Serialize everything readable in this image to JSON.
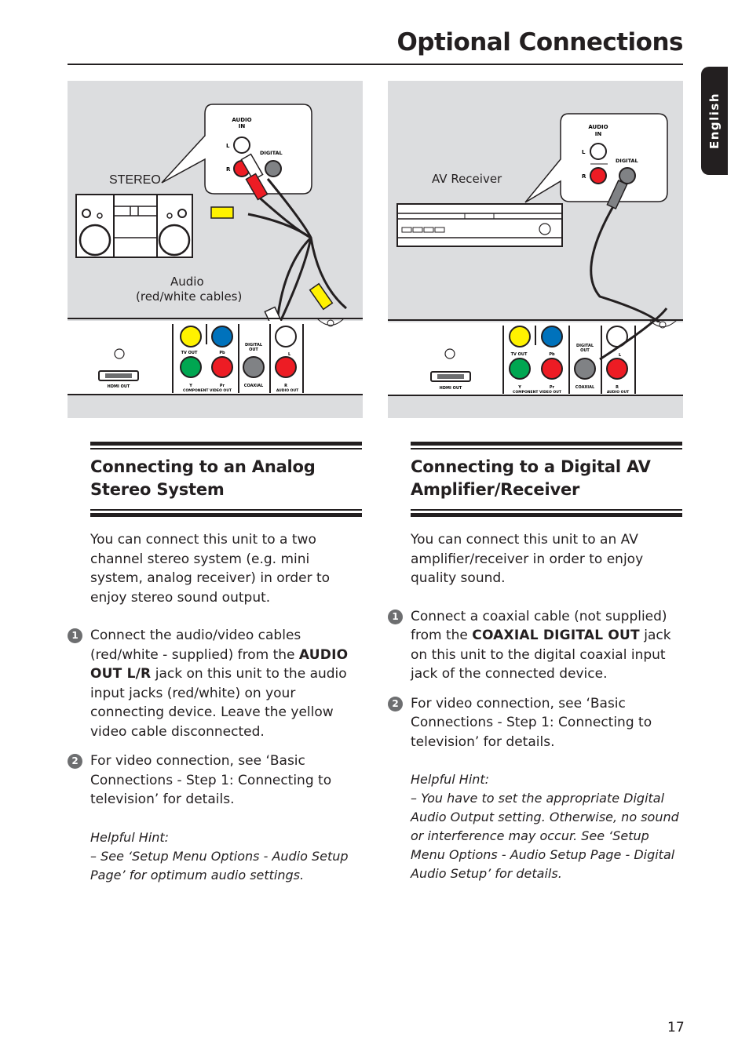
{
  "header": {
    "title": "Optional Connections",
    "language_tab": "English"
  },
  "figures": {
    "left": {
      "device_label": "STEREO",
      "cable_label_line1": "Audio",
      "cable_label_line2": "(red/white cables)",
      "callout": {
        "audio_in": "AUDIO",
        "audio_in2": "IN",
        "l": "L",
        "r": "R",
        "digital": "DIGITAL"
      }
    },
    "right": {
      "device_label": "AV Receiver",
      "callout": {
        "audio_in": "AUDIO",
        "audio_in2": "IN",
        "l": "L",
        "r": "R",
        "digital": "DIGITAL"
      }
    },
    "rear_panel": {
      "hdmi": "HDMI OUT",
      "tv_out": "TV OUT",
      "pb": "Pb",
      "y": "Y",
      "pr": "Pr",
      "component": "COMPONENT VIDEO OUT",
      "digital_out1": "DIGITAL",
      "digital_out2": "OUT",
      "coaxial": "COAXIAL",
      "l": "L",
      "r": "R",
      "audio_out": "AUDIO OUT"
    },
    "colors": {
      "panel_bg": "#dcdddf",
      "yellow": "#fff200",
      "blue": "#0072bc",
      "green": "#00a651",
      "red": "#ed1c24",
      "grey": "#808285"
    }
  },
  "sections": {
    "analog": {
      "title_line1": "Connecting to an Analog",
      "title_line2": "Stereo System",
      "intro": "You can connect this unit to a two channel stereo system (e.g. mini system, analog receiver) in order to enjoy stereo sound output.",
      "steps": [
        {
          "num": "1",
          "text_before": "Connect the audio/video cables (red/white - supplied) from the ",
          "strong": "AUDIO OUT L/R",
          "text_after": " jack on this unit to the audio input jacks (red/white) on your connecting device. Leave the yellow video cable disconnected."
        },
        {
          "num": "2",
          "text": "For video connection, see ‘Basic Connections - Step 1: Connecting to television’ for details."
        }
      ],
      "hint_title": "Helpful Hint:",
      "hint_text": "–  See ‘Setup Menu Options - Audio Setup Page’ for optimum audio settings."
    },
    "digital": {
      "title_line1": "Connecting to a Digital AV",
      "title_line2": "Amplifier/Receiver",
      "intro": "You can connect this unit to an AV amplifier/receiver in order to enjoy quality sound.",
      "steps": [
        {
          "num": "1",
          "text_before": "Connect a coaxial cable (not supplied) from the ",
          "strong": "COAXIAL DIGITAL OUT",
          "text_after": " jack on this unit to the digital coaxial input jack of the connected device."
        },
        {
          "num": "2",
          "text": "For video connection, see ‘Basic Connections - Step 1: Connecting to television’ for details."
        }
      ],
      "hint_title": "Helpful Hint:",
      "hint_text": "–  You have to set the appropriate Digital Audio Output setting. Otherwise, no sound or interference may occur. See ‘Setup Menu Options - Audio Setup Page - Digital Audio Setup’ for details."
    }
  },
  "footer": {
    "page_number": "17"
  }
}
